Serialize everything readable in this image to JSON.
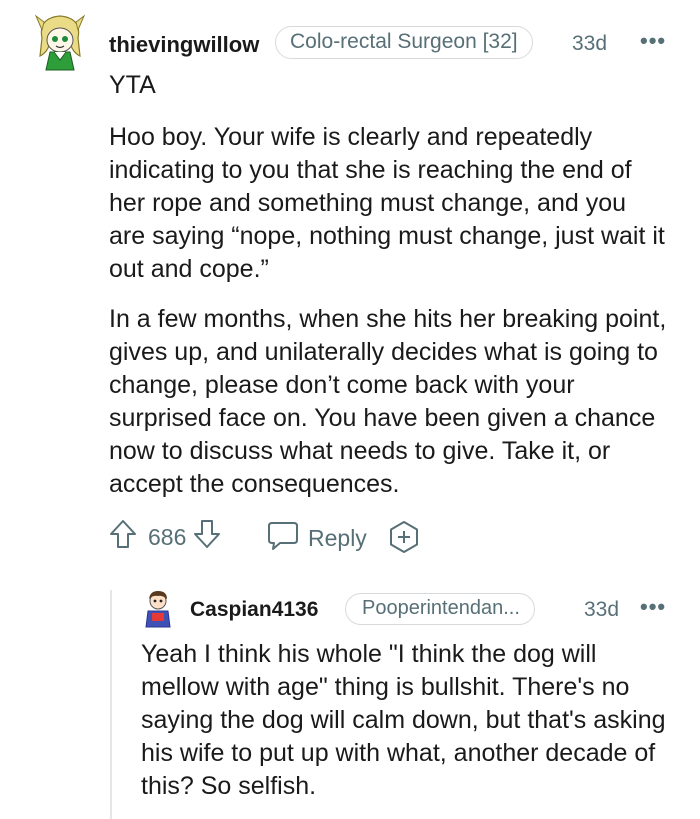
{
  "comment": {
    "username": "thievingwillow",
    "flair": "Colo-rectal Surgeon [32]",
    "age": "33d",
    "more": "•••",
    "verdict": "YTA",
    "paragraphs": [
      "Hoo boy. Your wife is clearly and repeatedly indicating to you that she is reaching the end of her rope and something must change, and you are saying “nope, nothing must change, just wait it out and cope.”",
      "In a few months, when she hits her breaking point, gives up, and unilaterally decides what is going to change, please don’t come back with your surprised face on. You have been given a chance now to discuss what needs to give. Take it, or accept the consequences."
    ],
    "votes": "686",
    "reply_label": "Reply",
    "icons": {
      "avatar": "avatar-icon",
      "upvote": "upvote-arrow-icon",
      "downvote": "downvote-arrow-icon",
      "reply": "speech-bubble-icon",
      "award": "award-plus-icon"
    }
  },
  "reply": {
    "username": "Caspian4136",
    "flair": "Pooperintendan...",
    "age": "33d",
    "more": "•••",
    "text": "Yeah I think his whole \"I think the dog will mellow with age\" thing is bullshit. There's no saying the dog will calm down, but that's asking his wife to put up with what, another decade of this? So selfish."
  },
  "colors": {
    "text": "#1a1a1b",
    "meta": "#576f76",
    "border": "#d7dadc",
    "avatar_green": "#2e7d32",
    "avatar_blonde": "#e8d77a"
  }
}
